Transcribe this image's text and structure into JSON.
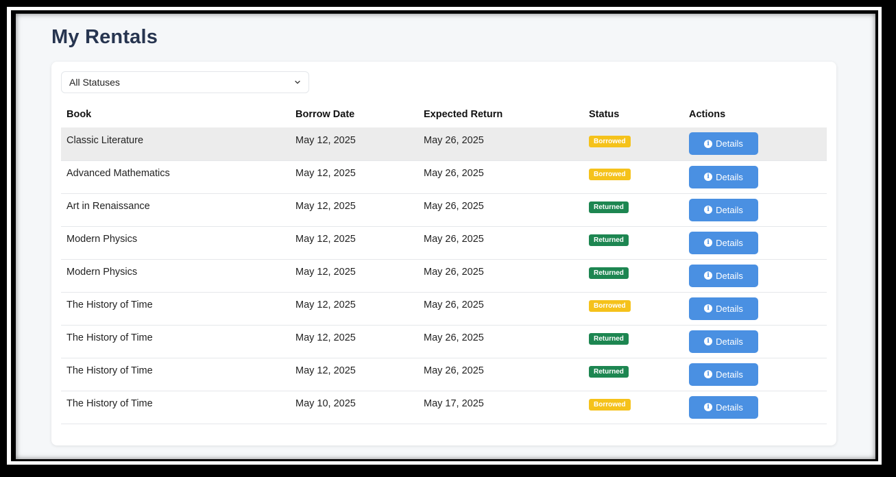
{
  "page": {
    "title": "My Rentals"
  },
  "filter": {
    "selected": "All Statuses",
    "icon": "chevron-down-icon"
  },
  "table": {
    "columns": [
      "Book",
      "Borrow Date",
      "Expected Return",
      "Status",
      "Actions"
    ],
    "rows": [
      {
        "book": "Classic Literature",
        "borrow": "May 12, 2025",
        "expected": "May 26, 2025",
        "status": "Borrowed",
        "action": "Details"
      },
      {
        "book": "Advanced Mathematics",
        "borrow": "May 12, 2025",
        "expected": "May 26, 2025",
        "status": "Borrowed",
        "action": "Details"
      },
      {
        "book": "Art in Renaissance",
        "borrow": "May 12, 2025",
        "expected": "May 26, 2025",
        "status": "Returned",
        "action": "Details"
      },
      {
        "book": "Modern Physics",
        "borrow": "May 12, 2025",
        "expected": "May 26, 2025",
        "status": "Returned",
        "action": "Details"
      },
      {
        "book": "Modern Physics",
        "borrow": "May 12, 2025",
        "expected": "May 26, 2025",
        "status": "Returned",
        "action": "Details"
      },
      {
        "book": "The History of Time",
        "borrow": "May 12, 2025",
        "expected": "May 26, 2025",
        "status": "Borrowed",
        "action": "Details"
      },
      {
        "book": "The History of Time",
        "borrow": "May 12, 2025",
        "expected": "May 26, 2025",
        "status": "Returned",
        "action": "Details"
      },
      {
        "book": "The History of Time",
        "borrow": "May 12, 2025",
        "expected": "May 26, 2025",
        "status": "Returned",
        "action": "Details"
      },
      {
        "book": "The History of Time",
        "borrow": "May 10, 2025",
        "expected": "May 17, 2025",
        "status": "Borrowed",
        "action": "Details"
      }
    ]
  },
  "colors": {
    "title": "#273550",
    "borrowed": "#f5c21b",
    "returned": "#1d8651",
    "button": "#4a90e2"
  }
}
